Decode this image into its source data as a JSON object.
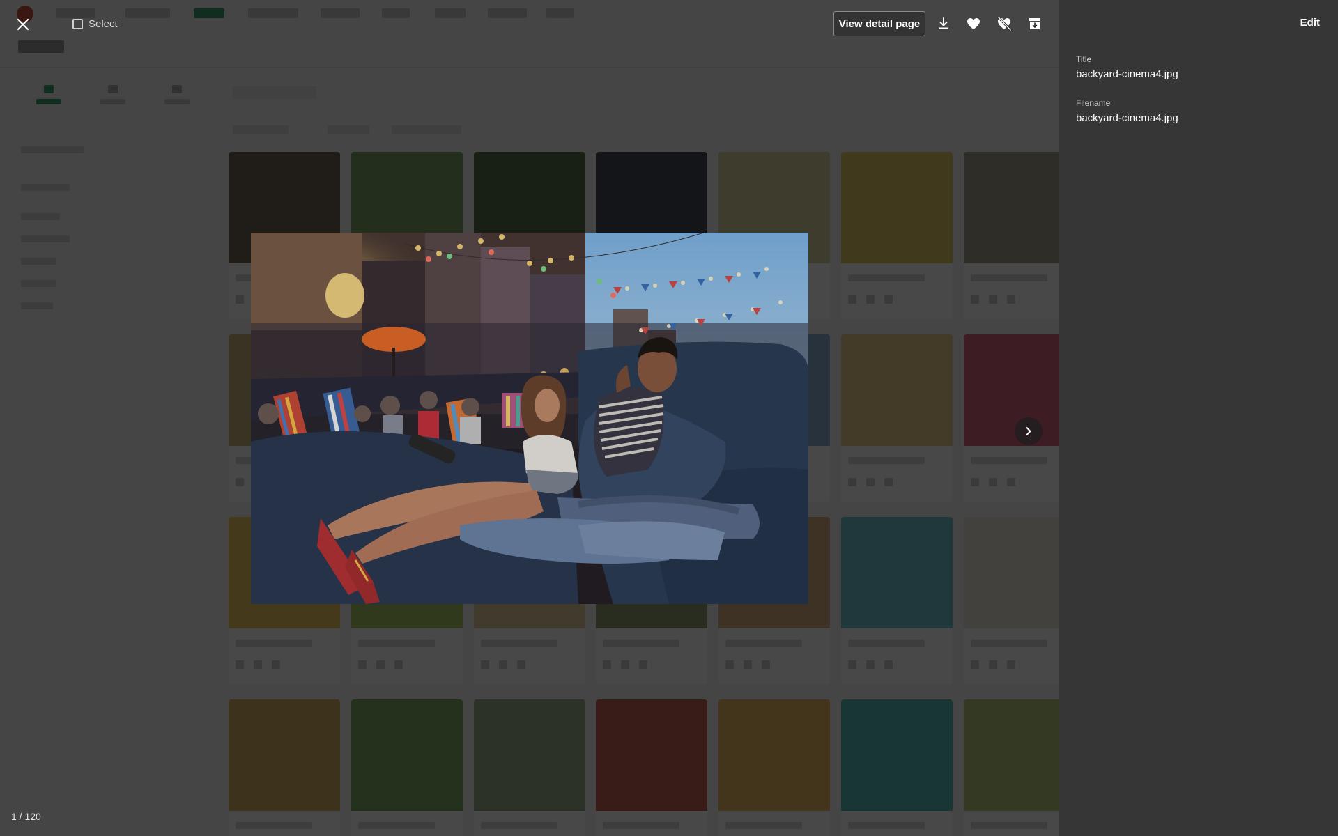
{
  "toolbar": {
    "close_icon": "close-icon",
    "select_label": "Select",
    "view_detail_label": "View detail page",
    "download_icon": "download-icon",
    "favorite_icon": "heart-icon",
    "unfavorite_icon": "heart-off-icon",
    "archive_icon": "archive-icon"
  },
  "viewer": {
    "next_icon": "chevron-right-icon",
    "counter": "1 / 120"
  },
  "panel": {
    "edit_label": "Edit",
    "fields": [
      {
        "label": "Title",
        "value": "backyard-cinema4.jpg"
      },
      {
        "label": "Filename",
        "value": "backyard-cinema4.jpg"
      }
    ]
  },
  "colors": {
    "panel_bg": "#363636",
    "accent": "#1f8a5a"
  }
}
